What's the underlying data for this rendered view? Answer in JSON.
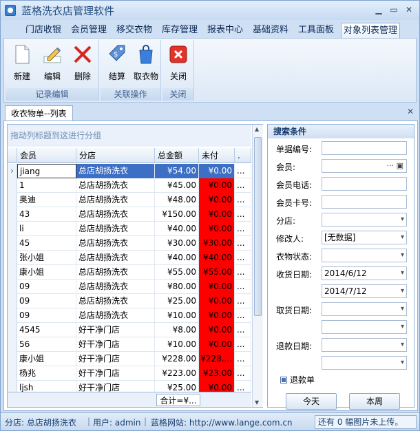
{
  "window": {
    "title": "蓝格洗衣店管理软件"
  },
  "menu_tabs": [
    "门店收银",
    "会员管理",
    "移交衣物",
    "库存管理",
    "报表中心",
    "基础资料",
    "工具面板",
    "对象列表管理"
  ],
  "ribbon": {
    "groups": [
      {
        "label": "记录编辑",
        "buttons": [
          "新建",
          "编辑",
          "删除"
        ]
      },
      {
        "label": "关联操作",
        "buttons": [
          "结算",
          "取衣物"
        ]
      },
      {
        "label": "关闭",
        "buttons": [
          "关闭"
        ]
      }
    ]
  },
  "doc_tab": "收衣物单--列表",
  "grid": {
    "group_hint": "拖动列标题到这进行分组",
    "columns": [
      "会员",
      "分店",
      "总金额",
      "未付",
      "."
    ],
    "rows": [
      {
        "member": "jiang",
        "store": "总店胡扬洗衣",
        "total": "¥54.00",
        "unpaid": "¥0.00",
        "more": "..."
      },
      {
        "member": "1",
        "store": "总店胡扬洗衣",
        "total": "¥45.00",
        "unpaid": "¥0.00",
        "more": "..."
      },
      {
        "member": "奥迪",
        "store": "总店胡扬洗衣",
        "total": "¥48.00",
        "unpaid": "¥0.00",
        "more": "..."
      },
      {
        "member": "43",
        "store": "总店胡扬洗衣",
        "total": "¥150.00",
        "unpaid": "¥0.00",
        "more": "..."
      },
      {
        "member": "li",
        "store": "总店胡扬洗衣",
        "total": "¥40.00",
        "unpaid": "¥0.00",
        "more": "..."
      },
      {
        "member": "45",
        "store": "总店胡扬洗衣",
        "total": "¥30.00",
        "unpaid": "¥30.00",
        "more": "..."
      },
      {
        "member": "张小姐",
        "store": "总店胡扬洗衣",
        "total": "¥40.00",
        "unpaid": "¥40.00",
        "more": "..."
      },
      {
        "member": "康小姐",
        "store": "总店胡扬洗衣",
        "total": "¥55.00",
        "unpaid": "¥55.00",
        "more": "..."
      },
      {
        "member": "09",
        "store": "总店胡扬洗衣",
        "total": "¥80.00",
        "unpaid": "¥0.00",
        "more": "..."
      },
      {
        "member": "09",
        "store": "总店胡扬洗衣",
        "total": "¥25.00",
        "unpaid": "¥0.00",
        "more": "..."
      },
      {
        "member": "09",
        "store": "总店胡扬洗衣",
        "total": "¥10.00",
        "unpaid": "¥0.00",
        "more": "..."
      },
      {
        "member": "4545",
        "store": "好干净门店",
        "total": "¥8.00",
        "unpaid": "¥0.00",
        "more": "..."
      },
      {
        "member": "56",
        "store": "好干净门店",
        "total": "¥10.00",
        "unpaid": "¥0.00",
        "more": "..."
      },
      {
        "member": "康小姐",
        "store": "好干净门店",
        "total": "¥228.00",
        "unpaid": "¥228....",
        "more": "..."
      },
      {
        "member": "杨兆",
        "store": "好干净门店",
        "total": "¥223.00",
        "unpaid": "¥23.00",
        "more": "..."
      },
      {
        "member": "ljsh",
        "store": "好干净门店",
        "total": "¥25.00",
        "unpaid": "¥0.00",
        "more": "..."
      }
    ],
    "footer_sum": "合计=¥..."
  },
  "search": {
    "title": "搜索条件",
    "fields": [
      {
        "label": "单据编号:",
        "value": ""
      },
      {
        "label": "会员:",
        "value": ""
      },
      {
        "label": "会员电话:",
        "value": ""
      },
      {
        "label": "会员卡号:",
        "value": ""
      },
      {
        "label": "分店:",
        "value": ""
      },
      {
        "label": "修改人:",
        "value": "[无数据]"
      },
      {
        "label": "衣物状态:",
        "value": ""
      },
      {
        "label": "收货日期:",
        "value": "2014/6/12"
      },
      {
        "label": "",
        "value": "2014/7/12"
      },
      {
        "label": "取货日期:",
        "value": ""
      },
      {
        "label": "",
        "value": ""
      },
      {
        "label": "退款日期:",
        "value": ""
      },
      {
        "label": "",
        "value": ""
      }
    ],
    "refund_checkbox": "退款单",
    "today_button": "今天",
    "week_button": "本周"
  },
  "status_bar": {
    "store": "分店: 总店胡扬洗衣",
    "user": "用户: admin",
    "website": "蓝格网站: http://www.lange.com.cn",
    "upload": "还有 0 幅图片未上传。"
  }
}
